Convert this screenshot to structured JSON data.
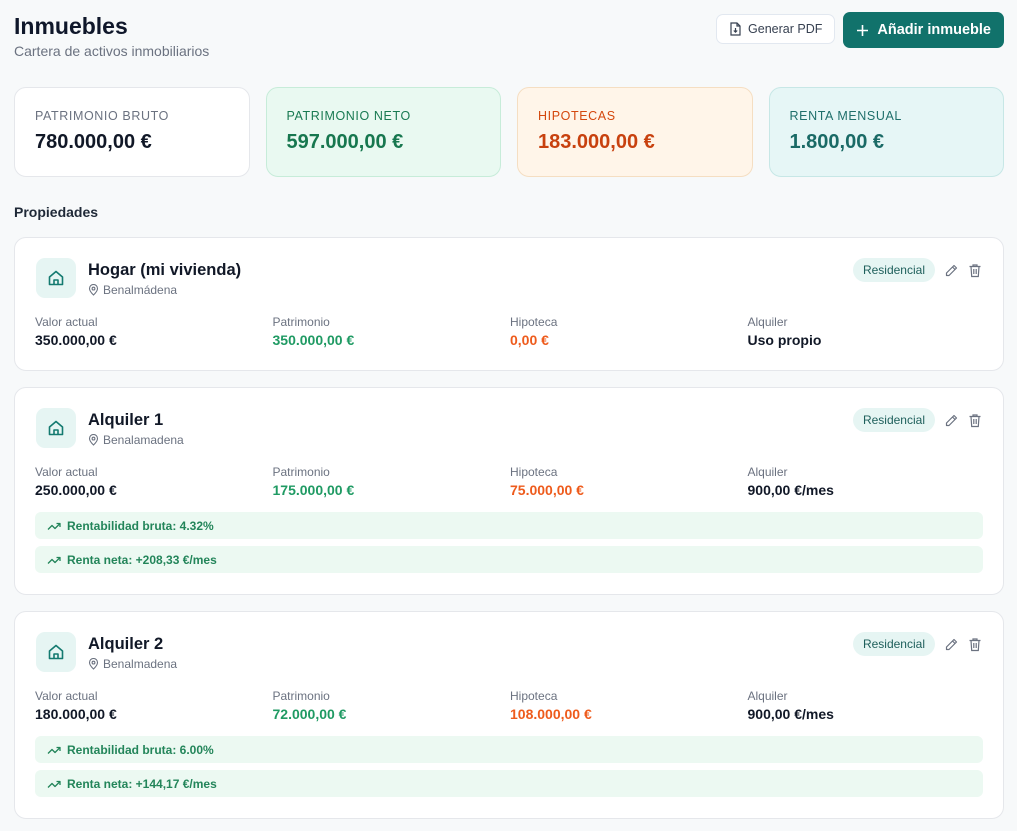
{
  "header": {
    "title": "Inmuebles",
    "subtitle": "Cartera de activos inmobiliarios",
    "pdf_label": "Generar PDF",
    "add_label": "Añadir inmueble"
  },
  "kpis": [
    {
      "label": "Patrimonio bruto",
      "value": "780.000,00 €"
    },
    {
      "label": "Patrimonio neto",
      "value": "597.000,00 €"
    },
    {
      "label": "Hipotecas",
      "value": "183.000,00 €"
    },
    {
      "label": "Renta mensual",
      "value": "1.800,00 €"
    }
  ],
  "section_title": "Propiedades",
  "labels": {
    "valor": "Valor actual",
    "patrimonio": "Patrimonio",
    "hipoteca": "Hipoteca",
    "alquiler": "Alquiler"
  },
  "properties": [
    {
      "name": "Hogar (mi vivienda)",
      "location": "Benalmádena",
      "badge": "Residencial",
      "valor": "350.000,00 €",
      "patrimonio": "350.000,00 €",
      "hipoteca": "0,00 €",
      "alquiler": "Uso propio"
    },
    {
      "name": "Alquiler 1",
      "location": "Benalamadena",
      "badge": "Residencial",
      "valor": "250.000,00 €",
      "patrimonio": "175.000,00 €",
      "hipoteca": "75.000,00 €",
      "alquiler": "900,00 €/mes",
      "rentabilidad": "Rentabilidad bruta: 4.32%",
      "renta_neta": "Renta neta: +208,33 €/mes"
    },
    {
      "name": "Alquiler 2",
      "location": "Benalmadena",
      "badge": "Residencial",
      "valor": "180.000,00 €",
      "patrimonio": "72.000,00 €",
      "hipoteca": "108.000,00 €",
      "alquiler": "900,00 €/mes",
      "rentabilidad": "Rentabilidad bruta: 6.00%",
      "renta_neta": "Renta neta: +144,17 €/mes"
    }
  ],
  "icons": {
    "pdf": "file-download-icon",
    "add": "plus-icon",
    "home": "house-icon",
    "location": "map-pin-icon",
    "edit": "pencil-icon",
    "delete": "trash-icon",
    "trend": "trending-up-icon"
  },
  "colors": {
    "primary": "#11726b",
    "positive": "#1f9a63",
    "negative": "#ee5b1c"
  }
}
